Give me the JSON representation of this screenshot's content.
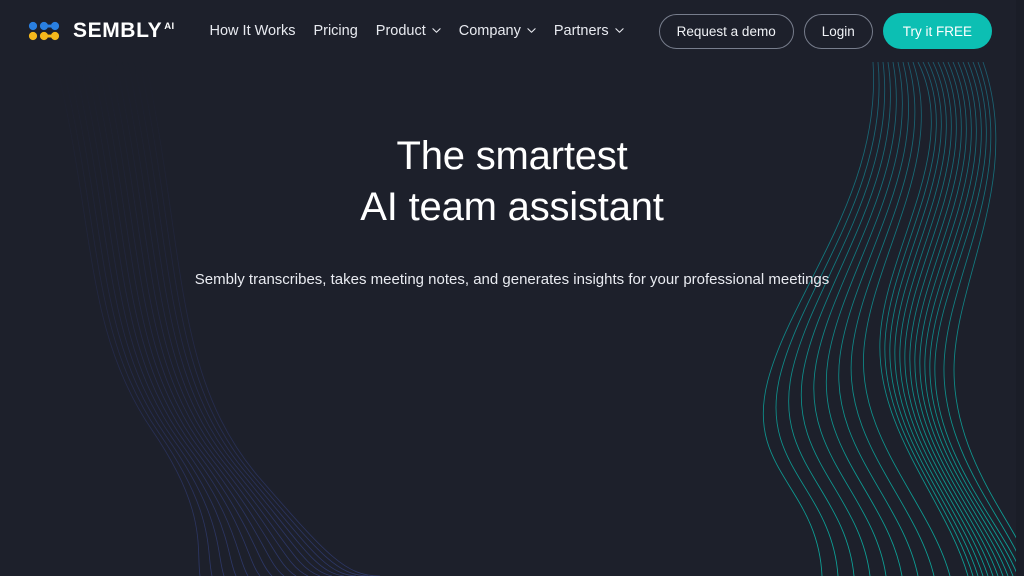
{
  "theme": {
    "background": "#1d202b",
    "header_background": "#1d202b",
    "accent_teal": "#0cbfb3",
    "text_primary": "#ffffff",
    "text_nav": "#e8eaf0",
    "border_outline": "#777d8c",
    "logo_blue": "#2a7fe0",
    "logo_yellow": "#f5b81c",
    "wave_teal": "#0d9a93",
    "wave_blue": "#2b3a7a"
  },
  "header": {
    "brand": {
      "name": "SEMBLY",
      "superscript": "AI",
      "logo_icon": "sembly-dots-logo"
    },
    "nav": [
      {
        "label": "How It Works",
        "has_dropdown": false
      },
      {
        "label": "Pricing",
        "has_dropdown": false
      },
      {
        "label": "Product",
        "has_dropdown": true,
        "icon": "chevron-down-icon"
      },
      {
        "label": "Company",
        "has_dropdown": true,
        "icon": "chevron-down-icon"
      },
      {
        "label": "Partners",
        "has_dropdown": true,
        "icon": "chevron-down-icon"
      }
    ],
    "actions": {
      "demo_label": "Request a demo",
      "login_label": "Login",
      "trial_label": "Try it FREE"
    }
  },
  "hero": {
    "title_line1": "The smartest",
    "title_line2": "AI team assistant",
    "subtitle": "Sembly transcribes, takes meeting notes, and generates insights for your professional meetings"
  }
}
